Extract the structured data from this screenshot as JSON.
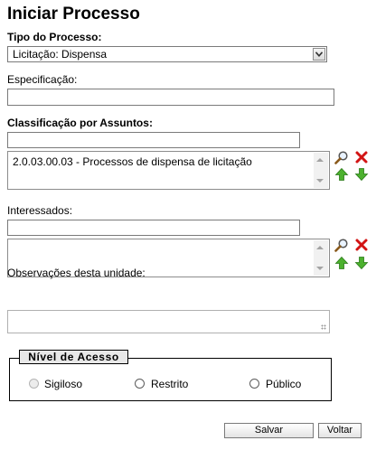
{
  "page": {
    "title": "Iniciar Processo"
  },
  "tipo": {
    "label": "Tipo do Processo:",
    "selected": "Licitação: Dispensa"
  },
  "especificacao": {
    "label": "Especificação:",
    "value": ""
  },
  "classificacao": {
    "label": "Classificação por Assuntos:",
    "search_value": "",
    "items": [
      "2.0.03.00.03 - Processos de dispensa de licitação"
    ]
  },
  "interessados": {
    "label": "Interessados:",
    "search_value": ""
  },
  "observacoes": {
    "label": "Observações desta unidade:",
    "value": ""
  },
  "nivel_acesso": {
    "legend": "Nível de Acesso",
    "options": [
      "Sigiloso",
      "Restrito",
      "Público"
    ]
  },
  "buttons": {
    "save": "Salvar",
    "back": "Voltar"
  },
  "icons": {
    "search": "magnifier-icon",
    "remove": "red-x-icon",
    "move_up": "green-up-arrow-icon",
    "move_down": "green-down-arrow-icon"
  }
}
